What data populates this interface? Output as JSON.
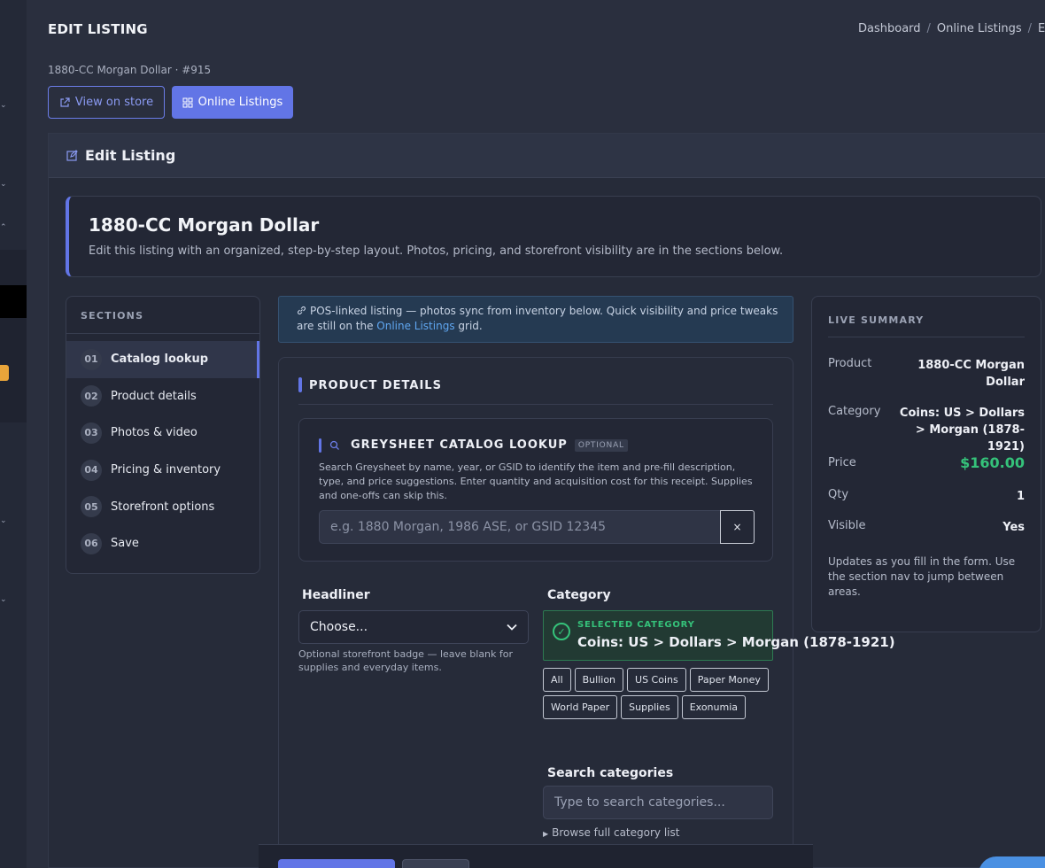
{
  "page": {
    "title": "EDIT LISTING",
    "subtitle": "1880-CC Morgan Dollar · #915"
  },
  "breadcrumb": {
    "items": [
      "Dashboard",
      "Online Listings",
      "E"
    ]
  },
  "actions": {
    "view_on_store": "View on store",
    "online_listings": "Online Listings"
  },
  "card": {
    "header": "Edit Listing"
  },
  "hero": {
    "title": "1880-CC Morgan Dollar",
    "description": "Edit this listing with an organized, step-by-step layout. Photos, pricing, and storefront visibility are in the sections below."
  },
  "sections": {
    "heading": "SECTIONS",
    "items": [
      {
        "num": "01",
        "label": "Catalog lookup",
        "active": true
      },
      {
        "num": "02",
        "label": "Product details"
      },
      {
        "num": "03",
        "label": "Photos & video"
      },
      {
        "num": "04",
        "label": "Pricing & inventory"
      },
      {
        "num": "05",
        "label": "Storefront options"
      },
      {
        "num": "06",
        "label": "Save"
      }
    ]
  },
  "banner": {
    "text_before": "POS-linked listing — photos sync from inventory below. Quick visibility and price tweaks are still on the ",
    "link": "Online Listings",
    "text_after": " grid."
  },
  "product_details": {
    "title": "PRODUCT DETAILS",
    "greysheet": {
      "title": "GREYSHEET CATALOG LOOKUP",
      "badge": "OPTIONAL",
      "description": "Search Greysheet by name, year, or GSID to identify the item and pre-fill description, type, and price suggestions. Enter quantity and acquisition cost for this receipt. Supplies and one-offs can skip this.",
      "placeholder": "e.g. 1880 Morgan, 1986 ASE, or GSID 12345",
      "clear": "×"
    },
    "headliner": {
      "label": "Headliner",
      "value": "Choose...",
      "help": "Optional storefront badge — leave blank for supplies and everyday items."
    },
    "category": {
      "label": "Category",
      "selected_caption": "SELECTED CATEGORY",
      "selected_value": "Coins: US > Dollars > Morgan (1878-1921)",
      "pills": [
        "All",
        "Bullion",
        "US Coins",
        "Paper Money",
        "World Paper",
        "Supplies",
        "Exonumia"
      ],
      "search_label": "Search categories",
      "search_placeholder": "Type to search categories...",
      "browse": "Browse full category list"
    }
  },
  "summary": {
    "heading": "LIVE SUMMARY",
    "product_label": "Product",
    "product_value": "1880-CC Morgan Dollar",
    "category_label": "Category",
    "category_value": "Coins: US > Dollars > Morgan (1878-1921)",
    "price_label": "Price",
    "price_value": "$160.00",
    "qty_label": "Qty",
    "qty_value": "1",
    "visible_label": "Visible",
    "visible_value": "Yes",
    "note": "Updates as you fill in the form. Use the section nav to jump between areas."
  },
  "colors": {
    "accent": "#6275e6",
    "success": "#35c27a",
    "link": "#5fa6f0",
    "background": "#2a2f3e"
  },
  "icons": {
    "view_on_store": "external-link-icon",
    "online_listings": "grid-icon",
    "edit": "edit-icon",
    "search": "search-icon",
    "link": "link-icon",
    "check": "check-circle-icon",
    "chevron": "chevron-down-icon",
    "browse": "triangle-right-icon"
  }
}
